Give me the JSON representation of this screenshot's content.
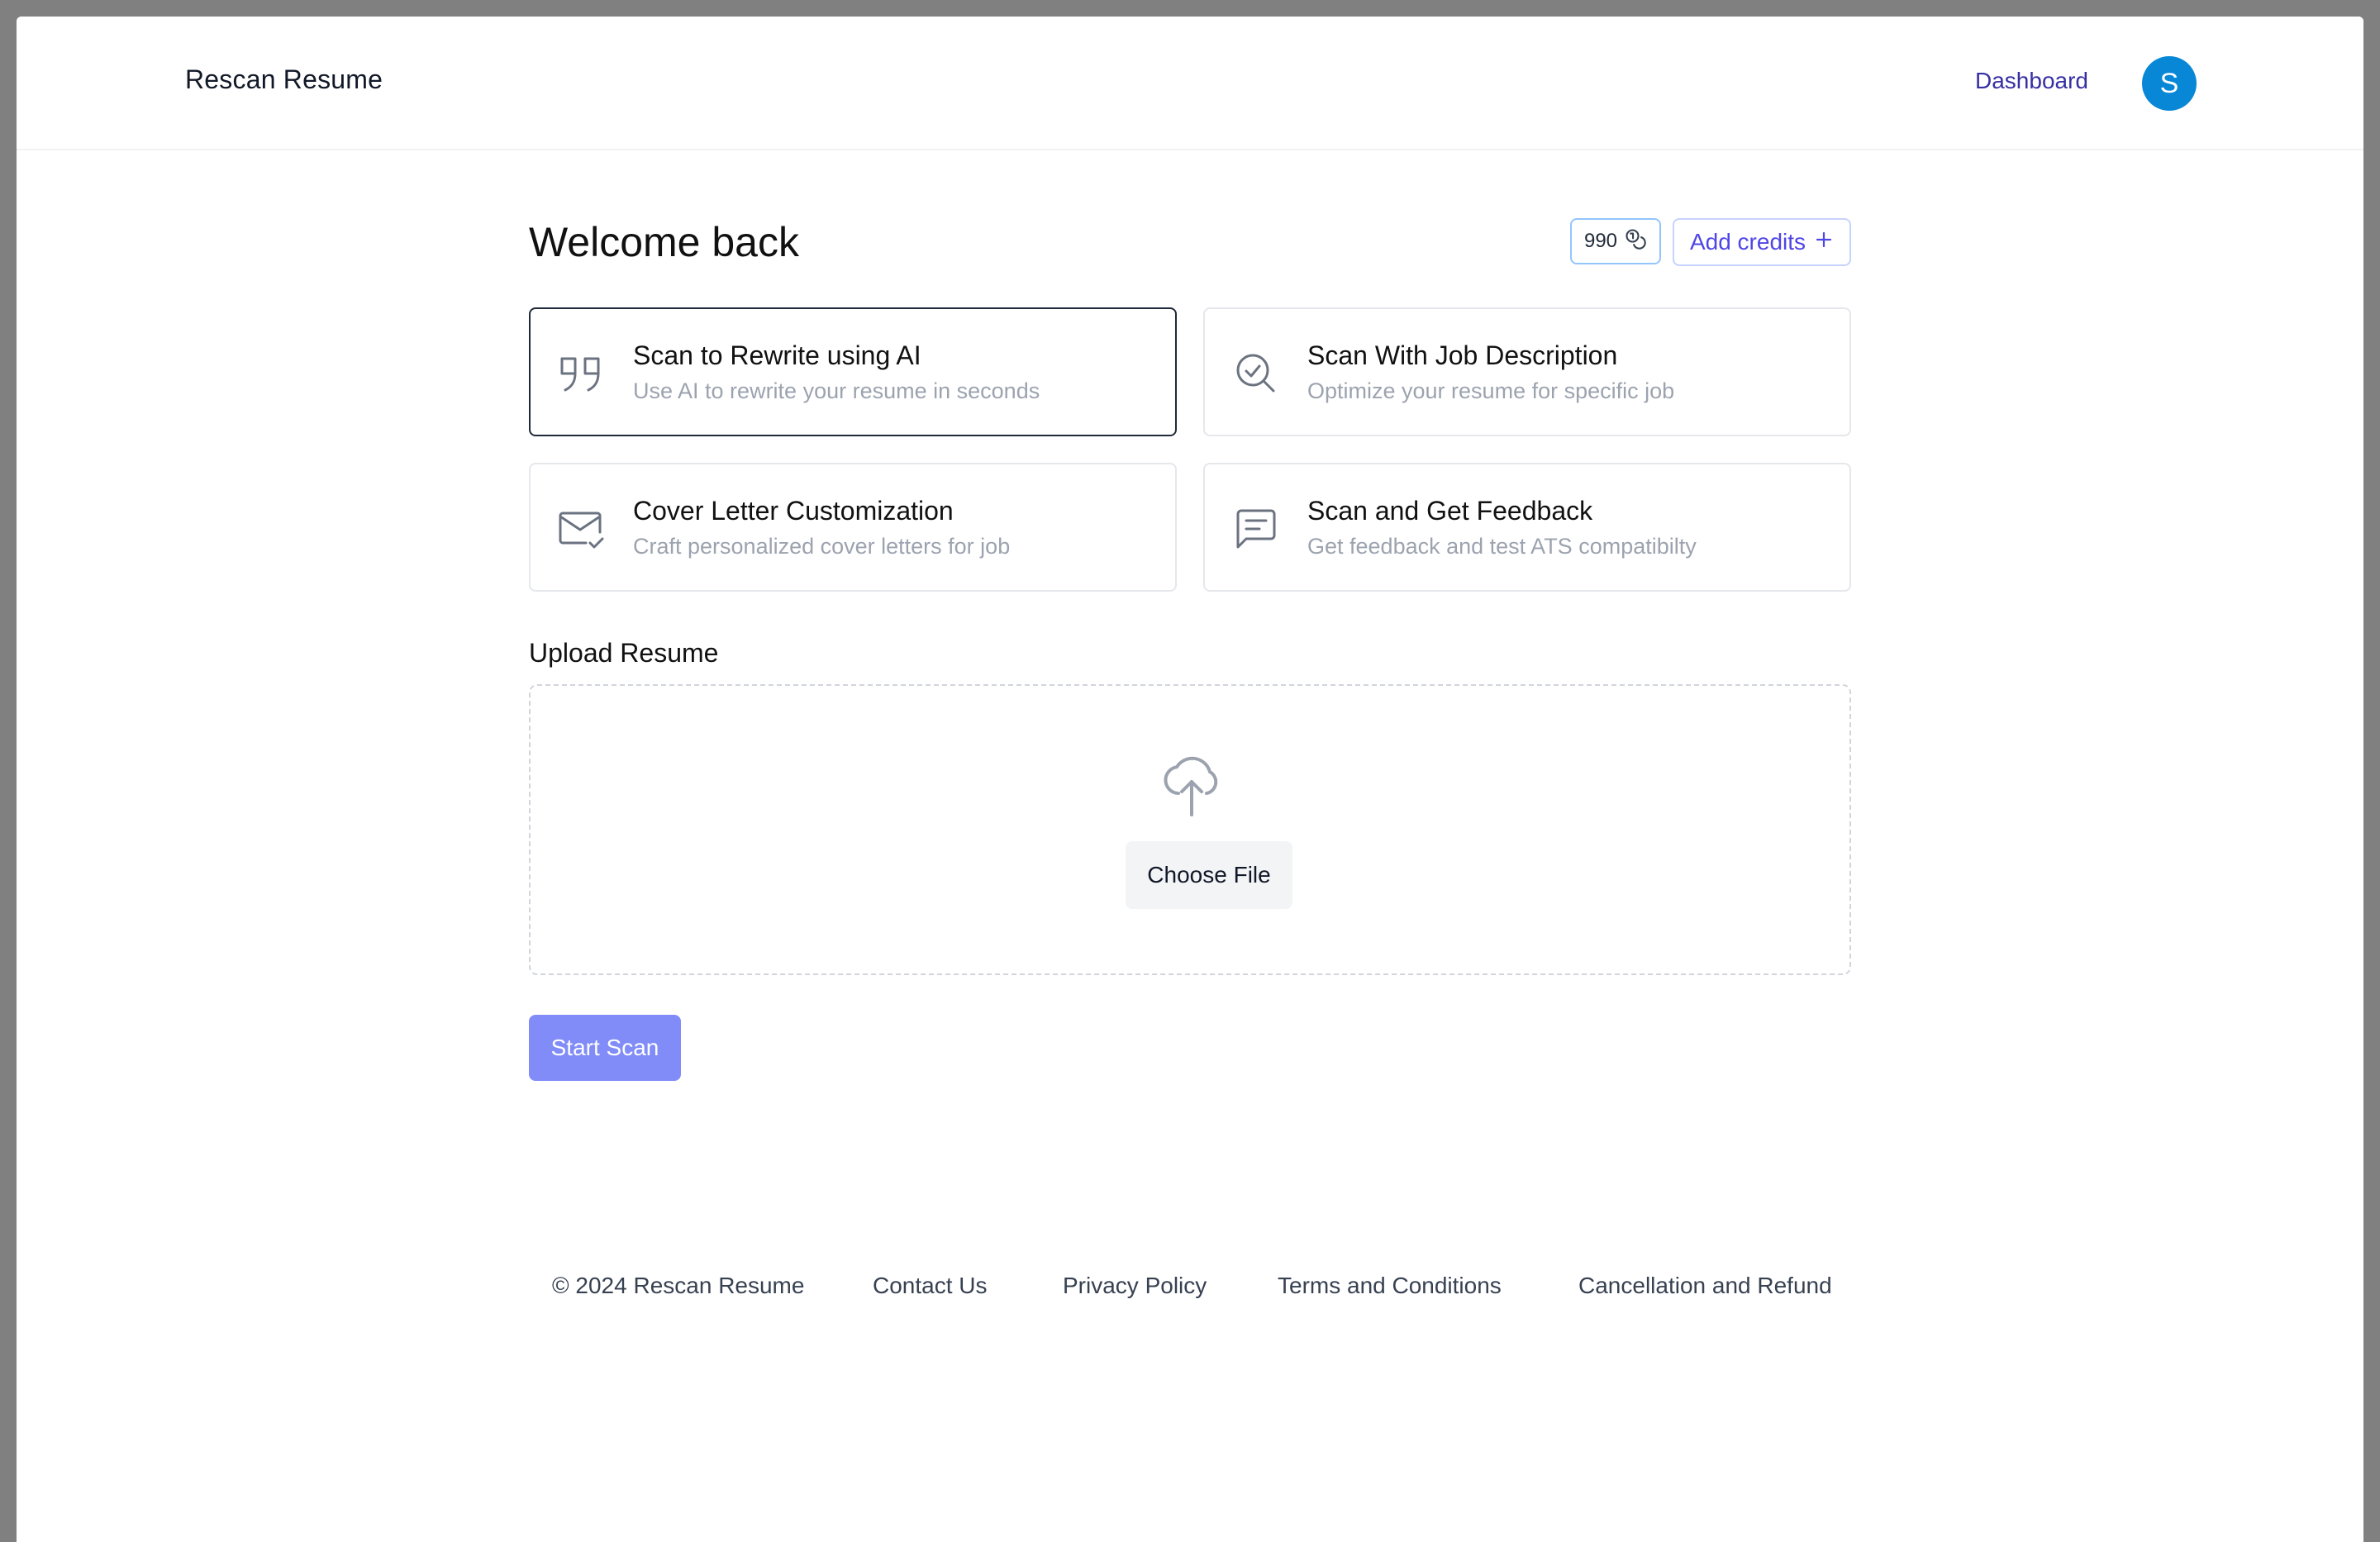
{
  "header": {
    "brand": "Rescan Resume",
    "nav_dashboard": "Dashboard",
    "avatar_initial": "S"
  },
  "main": {
    "title": "Welcome back",
    "credits": "990",
    "add_credits_label": "Add credits",
    "cards": [
      {
        "title": "Scan to Rewrite using AI",
        "subtitle": "Use AI to rewrite your resume in seconds",
        "icon": "quote-icon",
        "selected": true
      },
      {
        "title": "Scan With Job Description",
        "subtitle": "Optimize your resume for specific job",
        "icon": "search-check-icon",
        "selected": false
      },
      {
        "title": "Cover Letter Customization",
        "subtitle": "Craft personalized cover letters for job",
        "icon": "mail-check-icon",
        "selected": false
      },
      {
        "title": "Scan and Get Feedback",
        "subtitle": "Get feedback and test ATS compatibilty",
        "icon": "message-square-icon",
        "selected": false
      }
    ],
    "upload_label": "Upload Resume",
    "choose_file_label": "Choose File",
    "start_scan_label": "Start Scan"
  },
  "footer": {
    "copyright": "© 2024 Rescan Resume",
    "contact": "Contact Us",
    "privacy": "Privacy Policy",
    "terms": "Terms and Conditions",
    "cancellation": "Cancellation and Refund"
  },
  "colors": {
    "accent": "#4f46e5",
    "start_scan_bg": "#818cf8",
    "avatar_bg": "#0787d6",
    "nav_link": "#3730a3"
  }
}
